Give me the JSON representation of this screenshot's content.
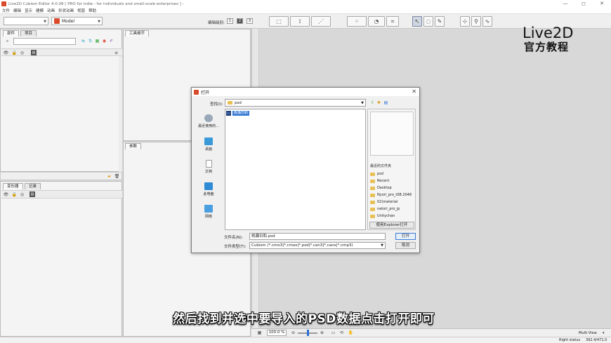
{
  "window": {
    "title": "Live2D Cubism Editor 4.0.08   [ PRO for indie - for individuals and small-scale enterprises ]  -",
    "controls": [
      "—",
      "◻",
      "✕"
    ]
  },
  "menu": [
    "文件",
    "编辑",
    "显示",
    "建模",
    "动画",
    "形状动画",
    "视窗",
    "帮助"
  ],
  "toolbar": {
    "model_select": "Model",
    "edit_level_label": "编辑级别:",
    "levels": [
      "1",
      "2",
      "3"
    ],
    "active_level": 1
  },
  "left_panel": {
    "tabs": [
      "部件",
      "项目"
    ],
    "lower_tabs": [
      "变形器",
      "记录"
    ]
  },
  "tool_detail": {
    "tab": "工具细节"
  },
  "params": {
    "tab": "参数"
  },
  "dialog": {
    "title": "打开",
    "lookin_label": "查找(I):",
    "lookin_value": "psd",
    "places": [
      "最近使用的...",
      "桌面",
      "文档",
      "此电脑",
      "网络"
    ],
    "files": [
      {
        "name": "桃瀬日和",
        "selected": true
      }
    ],
    "recent_folders_label": "最近的文件夹",
    "recent_folders": [
      "psd",
      "Recent",
      "Desktop",
      "Nyori_pro_t08.2048",
      "02)material",
      "natori_pro_jp",
      "Unitychan"
    ],
    "explorer_button": "使用Explorer打开",
    "filename_label": "文件名(N):",
    "filename_value": "桃瀬日和.psd",
    "filetype_label": "文件类型(T):",
    "filetype_value": "Cubism (*.cmo3|*.cmox|*.psd|*.can3|*.canx|*.cmp3)",
    "open_button": "打开",
    "cancel_button": "取消"
  },
  "status": {
    "zoom": "100.0 %",
    "view_mode": "Multi View",
    "right_status": "Right status",
    "coords": "392.4/471.0"
  },
  "watermark": {
    "line1": "Live2D",
    "line2": "官方教程"
  },
  "subtitle": "然后找到并选中要导入的PSD数据点击打开即可"
}
